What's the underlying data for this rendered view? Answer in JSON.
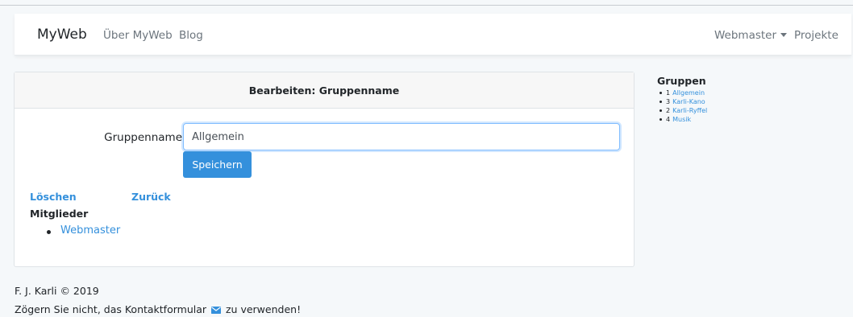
{
  "navbar": {
    "brand": "MyWeb",
    "links": [
      "Über MyWeb",
      "Blog"
    ],
    "user_menu": "Webmaster",
    "projects": "Projekte"
  },
  "card": {
    "header": "Bearbeiten: Gruppenname",
    "field_label": "Gruppenname",
    "field_value": "Allgemein",
    "save_button": "Speichern",
    "delete_link": "Löschen",
    "back_link": "Zurück",
    "members_title": "Mitglieder",
    "members": [
      "Webmaster"
    ]
  },
  "sidebar": {
    "title": "Gruppen",
    "groups": [
      {
        "num": "1",
        "name": "Allgemein"
      },
      {
        "num": "3",
        "name": "Karli-Kano"
      },
      {
        "num": "2",
        "name": "Karli-Ryffel"
      },
      {
        "num": "4",
        "name": "Musik"
      }
    ]
  },
  "footer": {
    "copyright": "F. J. Karli © 2019",
    "contact_before": "Zögern Sie nicht, das Kontaktformular",
    "contact_after": "zu verwenden!"
  },
  "colors": {
    "accent": "#3490dc"
  }
}
